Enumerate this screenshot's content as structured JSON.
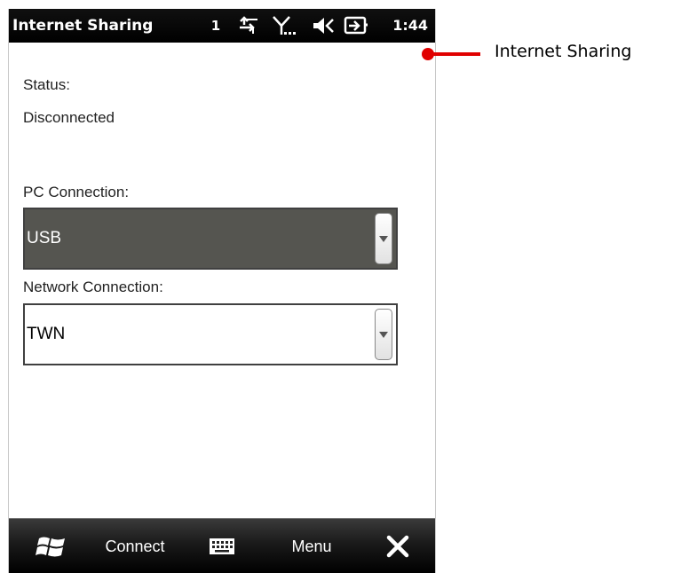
{
  "statusbar": {
    "title": "Internet Sharing",
    "notification_count": "1",
    "time": "1:44"
  },
  "main": {
    "status_label": "Status:",
    "status_value": "Disconnected",
    "pc_connection_label": "PC Connection:",
    "pc_connection_value": "USB",
    "network_connection_label": "Network Connection:",
    "network_connection_value": "TWN"
  },
  "softkeys": {
    "left": "Connect",
    "right": "Menu"
  },
  "callout": {
    "text": "Internet Sharing",
    "color": "#e00000"
  },
  "icons": [
    "data-sync-icon",
    "signal-icon",
    "speaker-muted-icon",
    "battery-charging-icon",
    "windows-start-icon",
    "keyboard-icon",
    "close-icon"
  ]
}
